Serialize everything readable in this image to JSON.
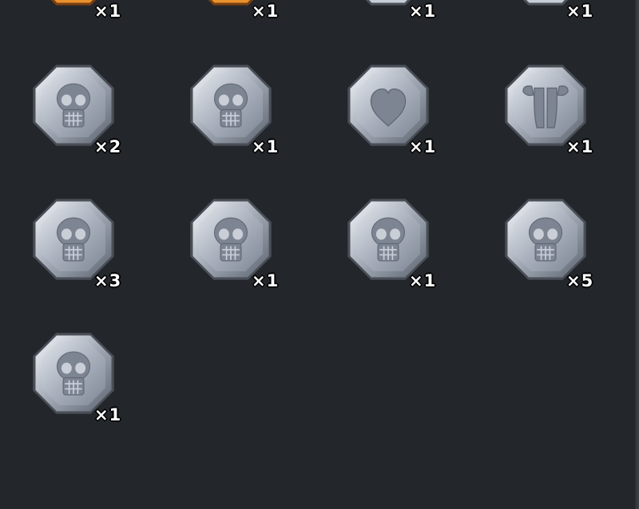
{
  "inventory": {
    "top_row_counts": [
      "×1",
      "×1",
      "×1",
      "×1"
    ],
    "items": [
      {
        "icon": "skull-medal-icon",
        "count": "×2"
      },
      {
        "icon": "skull-medal-icon",
        "count": "×1"
      },
      {
        "icon": "heart-medal-icon",
        "count": "×1"
      },
      {
        "icon": "armor-medal-icon",
        "count": "×1"
      },
      {
        "icon": "skull-medal-icon",
        "count": "×3"
      },
      {
        "icon": "skull-medal-icon",
        "count": "×1"
      },
      {
        "icon": "skull-medal-icon",
        "count": "×1"
      },
      {
        "icon": "skull-medal-icon",
        "count": "×5"
      },
      {
        "icon": "skull-medal-icon",
        "count": "×1"
      }
    ]
  },
  "colors": {
    "background": "#23272b",
    "silver_light": "#eef1f6",
    "silver_dark": "#6f7784",
    "bronze": "#d9862a",
    "count_text": "#ffffff"
  }
}
